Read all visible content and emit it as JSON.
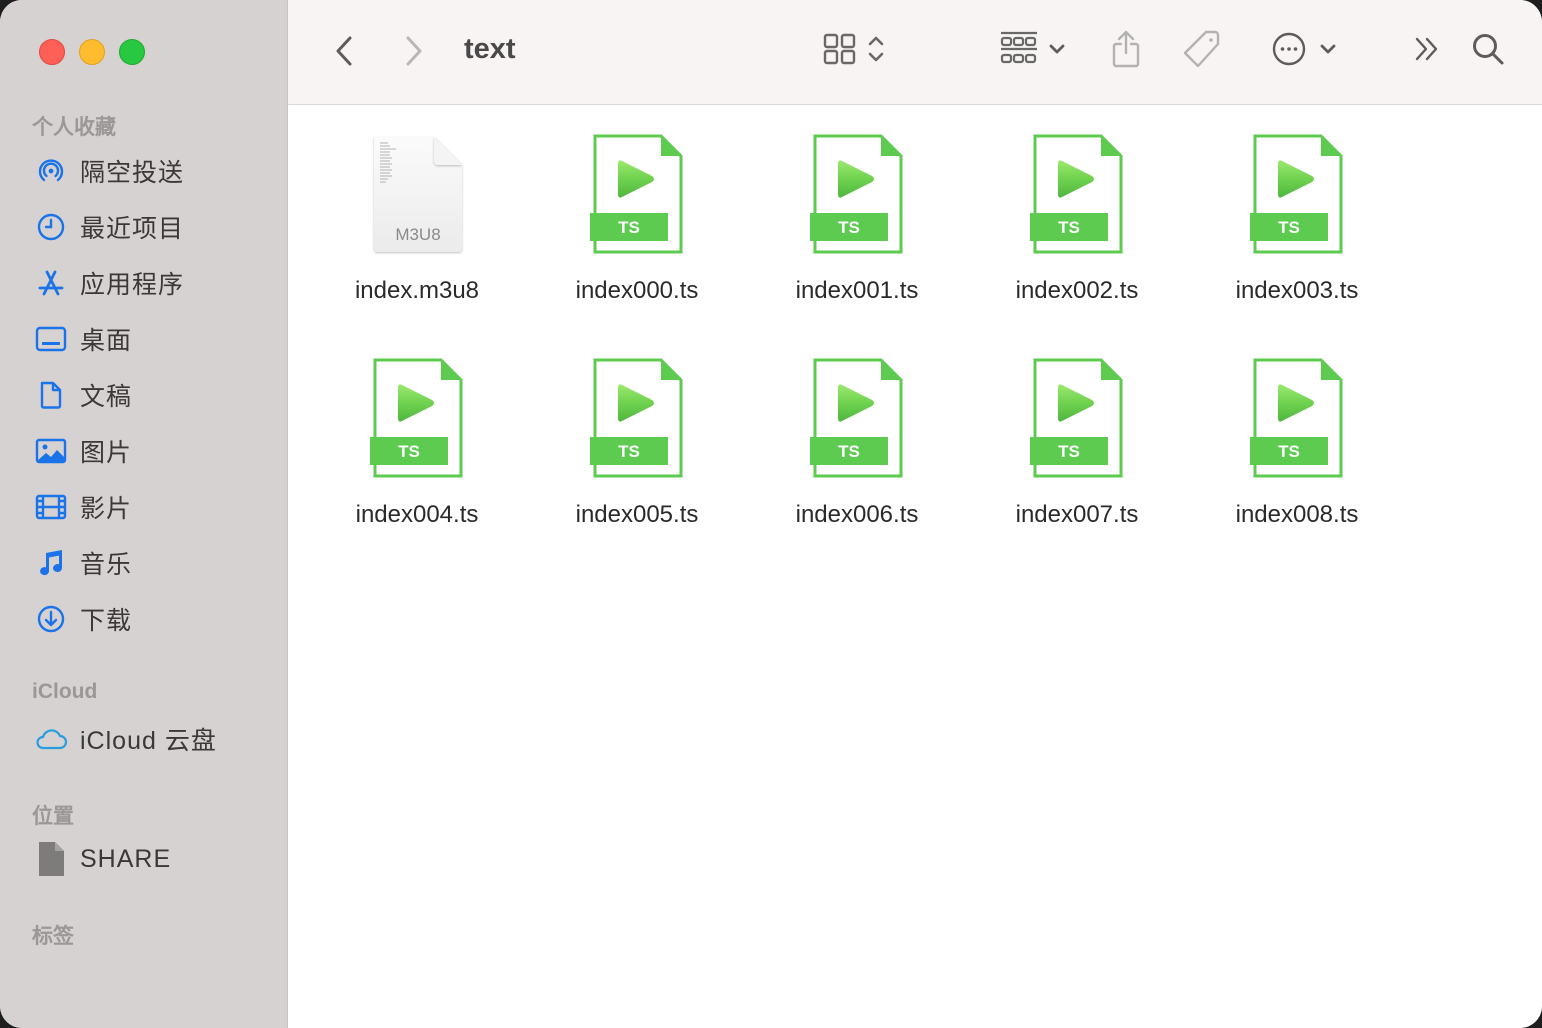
{
  "window": {
    "title": "text",
    "traffic_lights": [
      "close",
      "minimize",
      "zoom"
    ]
  },
  "sidebar": {
    "sections": [
      {
        "title": "个人收藏",
        "items": [
          {
            "label": "隔空投送",
            "icon": "airdrop-icon"
          },
          {
            "label": "最近项目",
            "icon": "clock-icon"
          },
          {
            "label": "应用程序",
            "icon": "applications-icon"
          },
          {
            "label": "桌面",
            "icon": "desktop-icon"
          },
          {
            "label": "文稿",
            "icon": "document-icon"
          },
          {
            "label": "图片",
            "icon": "photo-icon"
          },
          {
            "label": "影片",
            "icon": "film-icon"
          },
          {
            "label": "音乐",
            "icon": "music-note-icon"
          },
          {
            "label": "下载",
            "icon": "download-icon"
          }
        ]
      },
      {
        "title": "iCloud",
        "items": [
          {
            "label": "iCloud 云盘",
            "icon": "cloud-icon"
          }
        ]
      },
      {
        "title": "位置",
        "items": [
          {
            "label": "SHARE",
            "icon": "file-icon"
          }
        ]
      },
      {
        "title": "标签",
        "items": []
      }
    ]
  },
  "toolbar": {
    "back": "chevron-left-icon",
    "forward": "chevron-right-icon",
    "view_mode": "icon-grid-icon",
    "group": "group-by-icon",
    "share": "share-icon",
    "tag": "tag-icon",
    "action": "ellipsis-circle-icon",
    "more": "double-chevron-right-icon",
    "search": "search-icon"
  },
  "files": [
    {
      "name": "index.m3u8",
      "type": "m3u8",
      "badge": "M3U8"
    },
    {
      "name": "index000.ts",
      "type": "ts",
      "badge": "TS"
    },
    {
      "name": "index001.ts",
      "type": "ts",
      "badge": "TS"
    },
    {
      "name": "index002.ts",
      "type": "ts",
      "badge": "TS"
    },
    {
      "name": "index003.ts",
      "type": "ts",
      "badge": "TS"
    },
    {
      "name": "index004.ts",
      "type": "ts",
      "badge": "TS"
    },
    {
      "name": "index005.ts",
      "type": "ts",
      "badge": "TS"
    },
    {
      "name": "index006.ts",
      "type": "ts",
      "badge": "TS"
    },
    {
      "name": "index007.ts",
      "type": "ts",
      "badge": "TS"
    },
    {
      "name": "index008.ts",
      "type": "ts",
      "badge": "TS"
    }
  ],
  "colors": {
    "accent": "#1a73e8",
    "ts_green": "#5ccb4f",
    "sidebar_bg": "#d6d2d1",
    "toolbar_bg": "#f7f4f3"
  }
}
